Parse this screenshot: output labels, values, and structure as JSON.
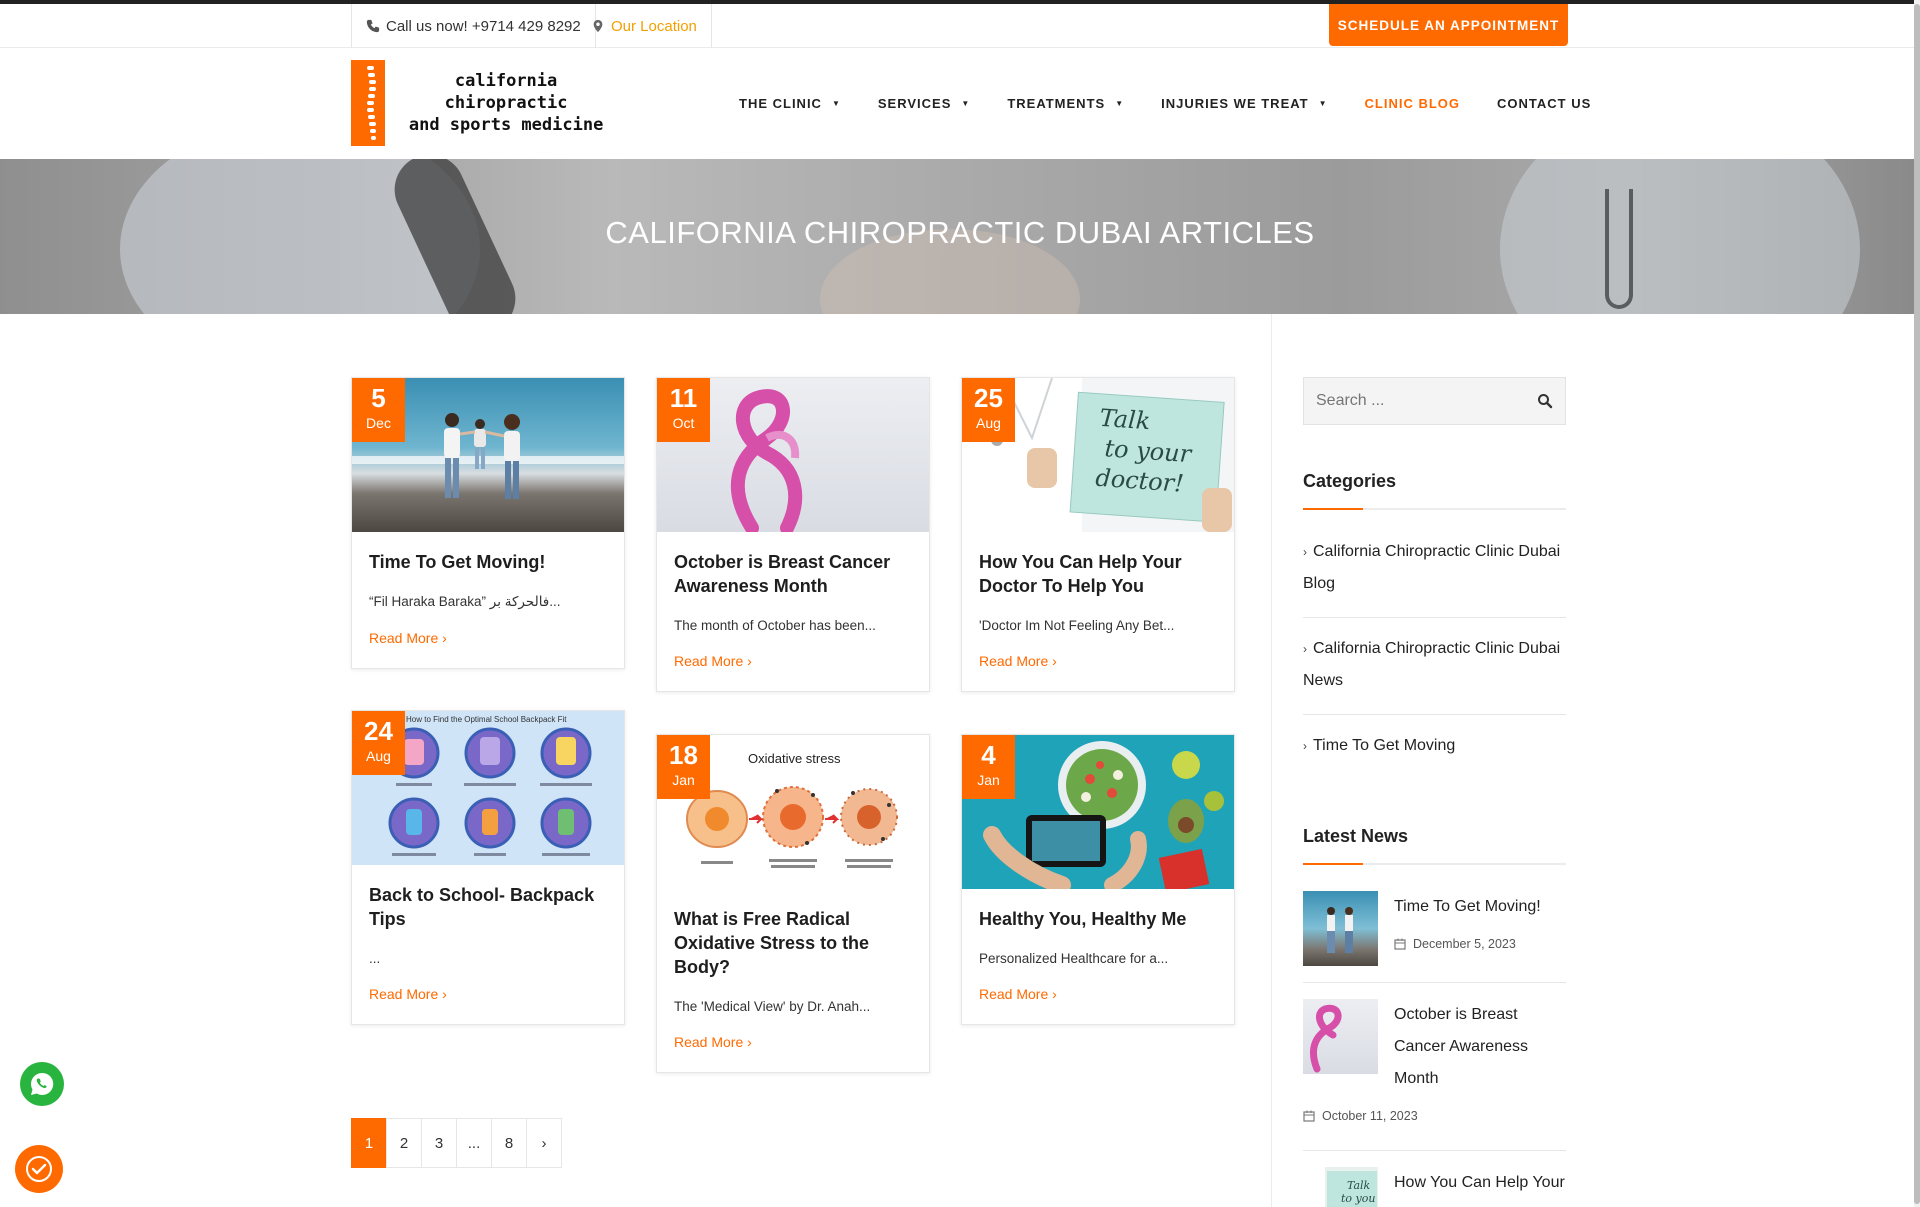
{
  "topbar": {
    "phone_label": "Call us now! +9714 429 8292",
    "location_label": "Our Location",
    "appointment_button": "SCHEDULE AN APPOINTMENT"
  },
  "logo": {
    "line1": "california chiropractic",
    "line2": "and sports medicine"
  },
  "nav": [
    {
      "label": "THE CLINIC",
      "dropdown": true
    },
    {
      "label": "SERVICES",
      "dropdown": true
    },
    {
      "label": "TREATMENTS",
      "dropdown": true
    },
    {
      "label": "INJURIES WE TREAT",
      "dropdown": true
    },
    {
      "label": "CLINIC BLOG",
      "active": true
    },
    {
      "label": "CONTACT US"
    }
  ],
  "hero": {
    "title": "CALIFORNIA CHIROPRACTIC DUBAI ARTICLES"
  },
  "posts": [
    {
      "day": "5",
      "month": "Dec",
      "title": "Time To Get Moving!",
      "excerpt": "“Fil Haraka Baraka” فالحركة بر...",
      "more": "Read More"
    },
    {
      "day": "11",
      "month": "Oct",
      "title": "October is Breast Cancer Awareness Month",
      "excerpt": "The month of October has been...",
      "more": "Read More"
    },
    {
      "day": "25",
      "month": "Aug",
      "title": "How You Can Help Your Doctor To Help You",
      "excerpt": "'Doctor Im Not Feeling Any Bet...",
      "more": "Read More"
    },
    {
      "day": "24",
      "month": "Aug",
      "title": "Back to School- Backpack Tips",
      "excerpt": "...",
      "more": "Read More",
      "image_caption": "How to Find the Optimal School Backpack Fit"
    },
    {
      "day": "18",
      "month": "Jan",
      "title": "What is Free Radical Oxidative Stress to the Body?",
      "excerpt": "The 'Medical View' by Dr. Anah...",
      "more": "Read More",
      "image_caption": "Oxidative stress"
    },
    {
      "day": "4",
      "month": "Jan",
      "title": "Healthy You, Healthy Me",
      "excerpt": "Personalized Healthcare for a...",
      "more": "Read More"
    }
  ],
  "pagination": {
    "pages": [
      "1",
      "2",
      "3",
      "...",
      "8"
    ],
    "current": "1",
    "next": "›"
  },
  "sidebar": {
    "search_placeholder": "Search ...",
    "categories_title": "Categories",
    "categories": [
      "California Chiropractic Clinic Dubai Blog",
      "California Chiropractic Clinic Dubai News",
      "Time To Get Moving"
    ],
    "latest_title": "Latest News",
    "latest": [
      {
        "title": "Time To Get Moving!",
        "date": "December 5, 2023"
      },
      {
        "title": "October is Breast Cancer Awareness Month",
        "date": "October 11, 2023"
      },
      {
        "title": "How You Can Help Your"
      }
    ]
  },
  "icons": {
    "phone": "phone-icon",
    "location": "map-pin-icon",
    "search": "search-icon",
    "calendar": "calendar-icon",
    "whatsapp": "whatsapp-icon",
    "cookie": "cookie-icon"
  },
  "colors": {
    "accent": "#ff6a00",
    "location": "#f2a000",
    "whatsapp": "#29b43f"
  }
}
